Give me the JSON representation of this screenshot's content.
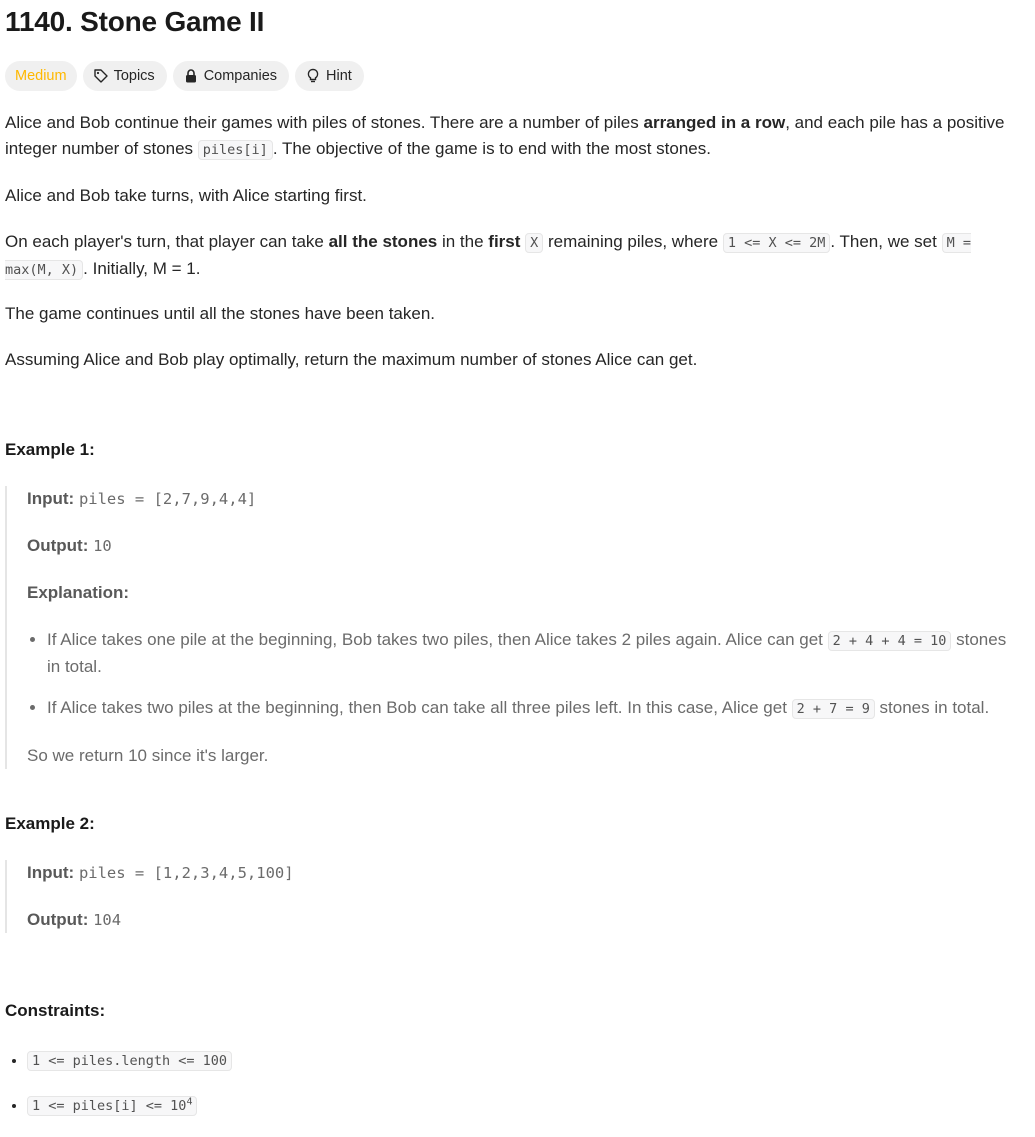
{
  "title": "1140. Stone Game II",
  "tags": {
    "difficulty": "Medium",
    "topics": "Topics",
    "companies": "Companies",
    "hint": "Hint"
  },
  "desc": {
    "p1_a": "Alice and Bob continue their games with piles of stones. There are a number of piles ",
    "p1_b": "arranged in a row",
    "p1_c": ", and each pile has a positive integer number of stones ",
    "p1_code": "piles[i]",
    "p1_d": ". The objective of the game is to end with the most stones.",
    "p2": "Alice and Bob take turns, with Alice starting first.",
    "p3_a": "On each player's turn, that player can take ",
    "p3_b": "all the stones",
    "p3_c": " in the ",
    "p3_d": "first",
    "p3_code1": "X",
    "p3_e": " remaining piles, where ",
    "p3_code2": "1 <= X <= 2M",
    "p3_f": ". Then, we set ",
    "p3_code3": "M = max(M, X)",
    "p3_g": ". Initially, M = 1.",
    "p4": "The game continues until all the stones have been taken.",
    "p5": "Assuming Alice and Bob play optimally, return the maximum number of stones Alice can get."
  },
  "example1": {
    "heading": "Example 1:",
    "input_label": "Input:",
    "input_value": "piles = [2,7,9,4,4]",
    "output_label": "Output:",
    "output_value": "10",
    "explanation_label": "Explanation:",
    "bullet1_a": "If Alice takes one pile at the beginning, Bob takes two piles, then Alice takes 2 piles again. Alice can get ",
    "bullet1_code": "2 + 4 + 4 = 10",
    "bullet1_b": " stones in total.",
    "bullet2_a": "If Alice takes two piles at the beginning, then Bob can take all three piles left. In this case, Alice get ",
    "bullet2_code": "2 + 7 = 9",
    "bullet2_b": " stones in total.",
    "conclusion": "So we return 10 since it's larger."
  },
  "example2": {
    "heading": "Example 2:",
    "input_label": "Input:",
    "input_value": "piles = [1,2,3,4,5,100]",
    "output_label": "Output:",
    "output_value": "104"
  },
  "constraints": {
    "heading": "Constraints:",
    "c1": "1 <= piles.length <= 100",
    "c2_a": "1 <= piles[i] <= 10",
    "c2_sup": "4"
  },
  "colors": {
    "medium": "#ffb800",
    "tag_bg": "#f0f0f0"
  }
}
